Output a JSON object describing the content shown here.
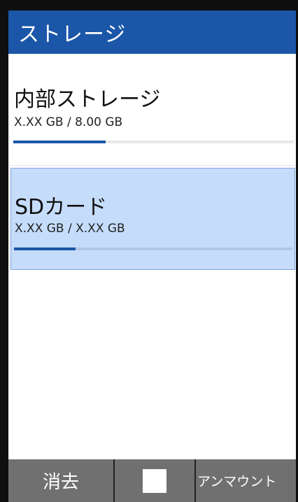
{
  "header": {
    "title": "ストレージ"
  },
  "storage": {
    "items": [
      {
        "label": "内部ストレージ",
        "size_text": "X.XX GB / 8.00 GB",
        "usage_fraction": 0.33,
        "selected": false
      },
      {
        "label": "SDカード",
        "size_text": "X.XX GB / X.XX GB",
        "usage_fraction": 0.22,
        "selected": true
      }
    ]
  },
  "softkeys": {
    "left_label": "消去",
    "center_icon": "square-icon",
    "right_label": "アンマウント"
  },
  "colors": {
    "accent": "#1b56a8",
    "selected_background": "#c5dcfb",
    "softkey_background": "#707070"
  }
}
